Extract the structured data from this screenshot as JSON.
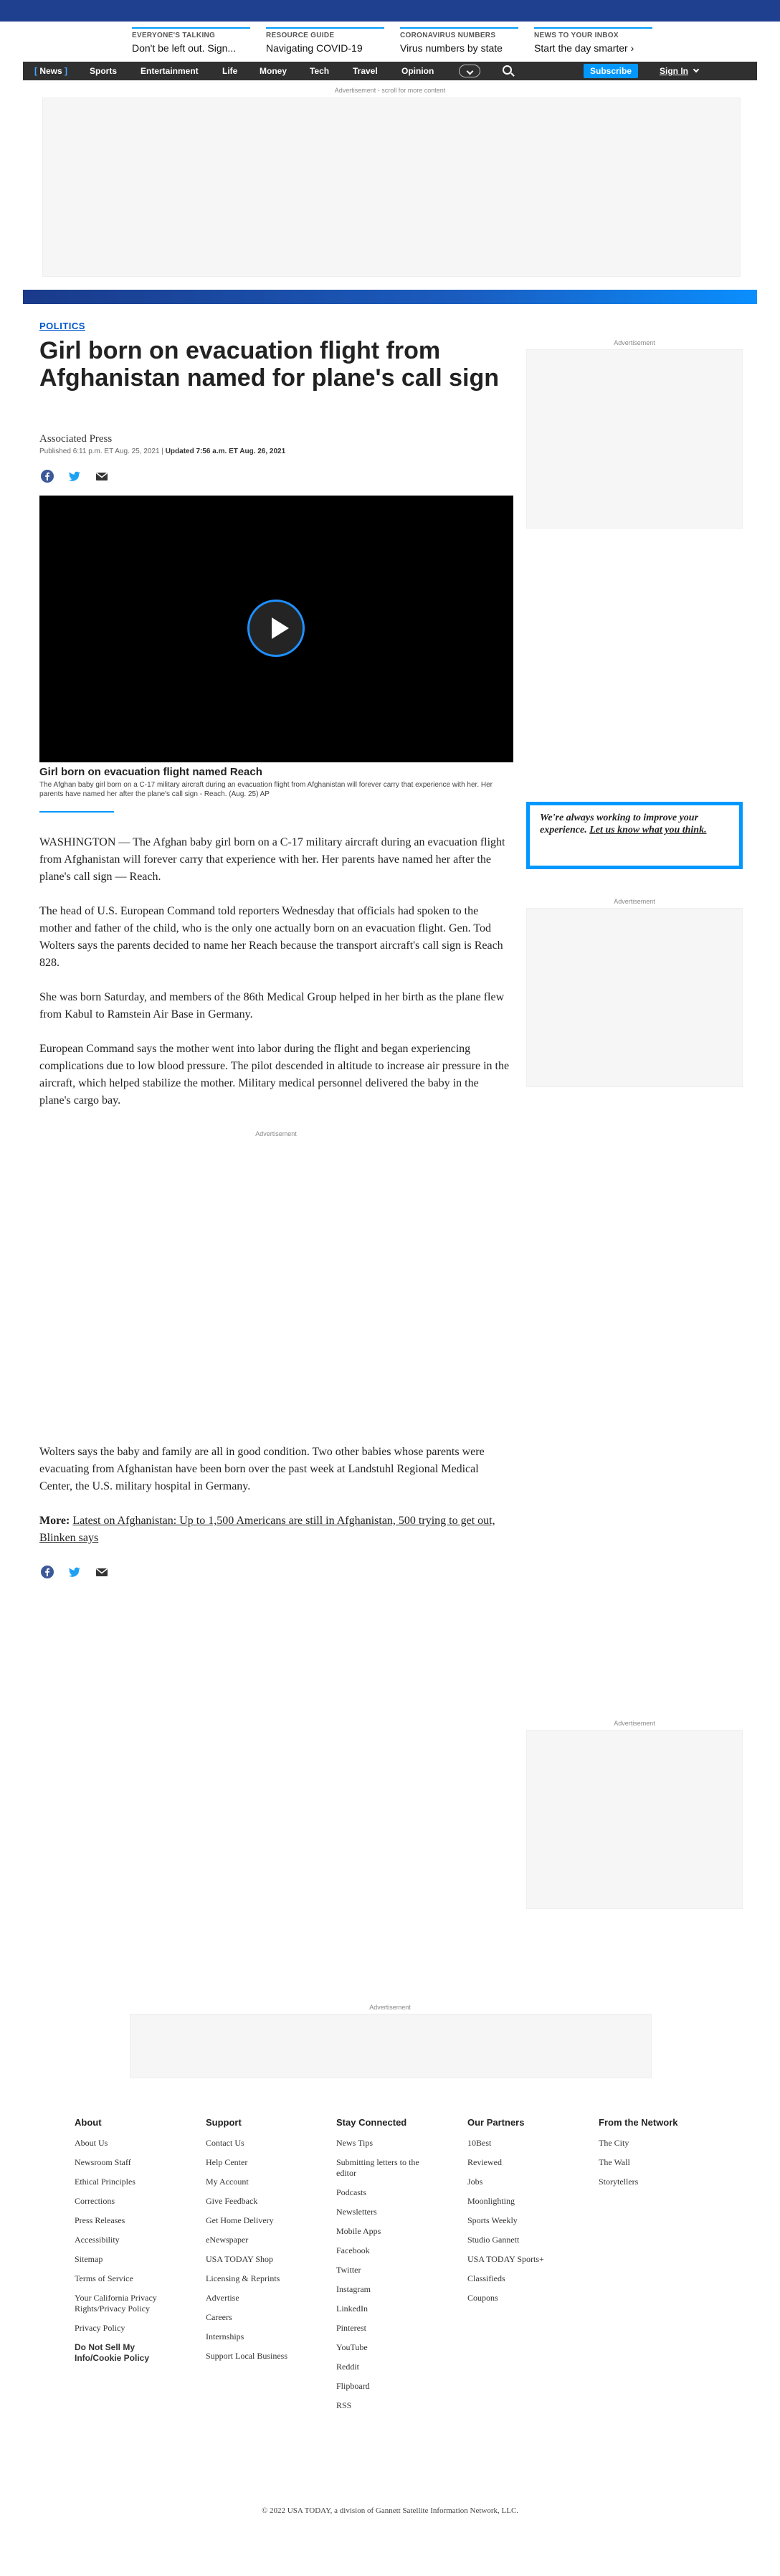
{
  "trending": [
    {
      "category": "EVERYONE'S TALKING",
      "title": "Don't be left out. Sign..."
    },
    {
      "category": "RESOURCE GUIDE",
      "title": "Navigating COVID-19"
    },
    {
      "category": "CORONAVIRUS NUMBERS",
      "title": "Virus numbers by state"
    },
    {
      "category": "NEWS TO YOUR INBOX",
      "title": "Start the day smarter ›"
    }
  ],
  "nav": {
    "items": [
      "News",
      "Sports",
      "Entertainment",
      "Life",
      "Money",
      "Tech",
      "Travel",
      "Opinion"
    ],
    "subscribe_label": "Subscribe",
    "signin_label": "Sign In",
    "brand_color": "#303030",
    "accent_color": "#0098fe"
  },
  "ads": {
    "top_label": "Advertisement - scroll for more content",
    "label": "Advertisement"
  },
  "article": {
    "section": "POLITICS",
    "headline": "Girl born on evacuation flight from Afghanistan named for plane's call sign",
    "author": "Associated Press",
    "published": "Published 6:11 p.m. ET Aug. 25, 2021",
    "updated": "Updated 7:56 a.m. ET Aug. 26, 2021",
    "video": {
      "title": "Girl born on evacuation flight named Reach",
      "caption": "The Afghan baby girl born on a C-17 military aircraft during an evacuation flight from Afghanistan will forever carry that experience with her. Her parents have named her after the plane's call sign - Reach. (Aug. 25) AP"
    },
    "paragraphs": [
      "WASHINGTON — The Afghan baby girl born on a C-17 military aircraft during an evacuation flight from Afghanistan will forever carry that experience with her. Her parents have named her after the plane's call sign — Reach.",
      "The head of U.S. European Command told reporters Wednesday that officials had spoken to the mother and father of the child, who is the only one actually born on an evacuation flight. Gen. Tod Wolters says the parents decided to name her Reach because the transport aircraft's call sign is Reach 828.",
      "She was born Saturday, and members of the 86th Medical Group helped in her birth as the plane flew from Kabul to Ramstein Air Base in Germany.",
      "European Command says the mother went into labor during the flight and began experiencing complications due to low blood pressure. The pilot descended in altitude to increase air pressure in the aircraft, which helped stabilize the mother. Military medical personnel delivered the baby in the plane's cargo bay.",
      "Wolters says the baby and family are all in good condition. Two other babies whose parents were evacuating from Afghanistan have been born over the past week at Landstuhl Regional Medical Center, the U.S. military hospital in Germany."
    ],
    "more_label": "More:",
    "more_text": "Latest on Afghanistan: Up to 1,500 Americans are still in Afghanistan, 500 trying to get out, Blinken says"
  },
  "feedback": {
    "text": "We're always working to improve your experience.",
    "link": "Let us know what you think."
  },
  "footer": {
    "columns": [
      {
        "heading": "About",
        "links": [
          "About Us",
          "Newsroom Staff",
          "Ethical Principles",
          "Corrections",
          "Press Releases",
          "Accessibility",
          "Sitemap",
          "Terms of Service",
          "Your California Privacy Rights/Privacy Policy",
          "Privacy Policy",
          "Do Not Sell My Info/Cookie Policy"
        ]
      },
      {
        "heading": "Support",
        "links": [
          "Contact Us",
          "Help Center",
          "My Account",
          "Give Feedback",
          "Get Home Delivery",
          "eNewspaper",
          "USA TODAY Shop",
          "Licensing & Reprints",
          "Advertise",
          "Careers",
          "Internships",
          "Support Local Business"
        ]
      },
      {
        "heading": "Stay Connected",
        "links": [
          "News Tips",
          "Submitting letters to the editor",
          "Podcasts",
          "Newsletters",
          "Mobile Apps",
          "Facebook",
          "Twitter",
          "Instagram",
          "LinkedIn",
          "Pinterest",
          "YouTube",
          "Reddit",
          "Flipboard",
          "RSS"
        ]
      },
      {
        "heading": "Our Partners",
        "links": [
          "10Best",
          "Reviewed",
          "Jobs",
          "Moonlighting",
          "Sports Weekly",
          "Studio Gannett",
          "USA TODAY Sports+",
          "Classifieds",
          "Coupons"
        ]
      },
      {
        "heading": "From the Network",
        "links": [
          "The City",
          "The Wall",
          "Storytellers"
        ]
      }
    ],
    "copyright": "© 2022 USA TODAY, a division of Gannett Satellite Information Network, LLC."
  }
}
